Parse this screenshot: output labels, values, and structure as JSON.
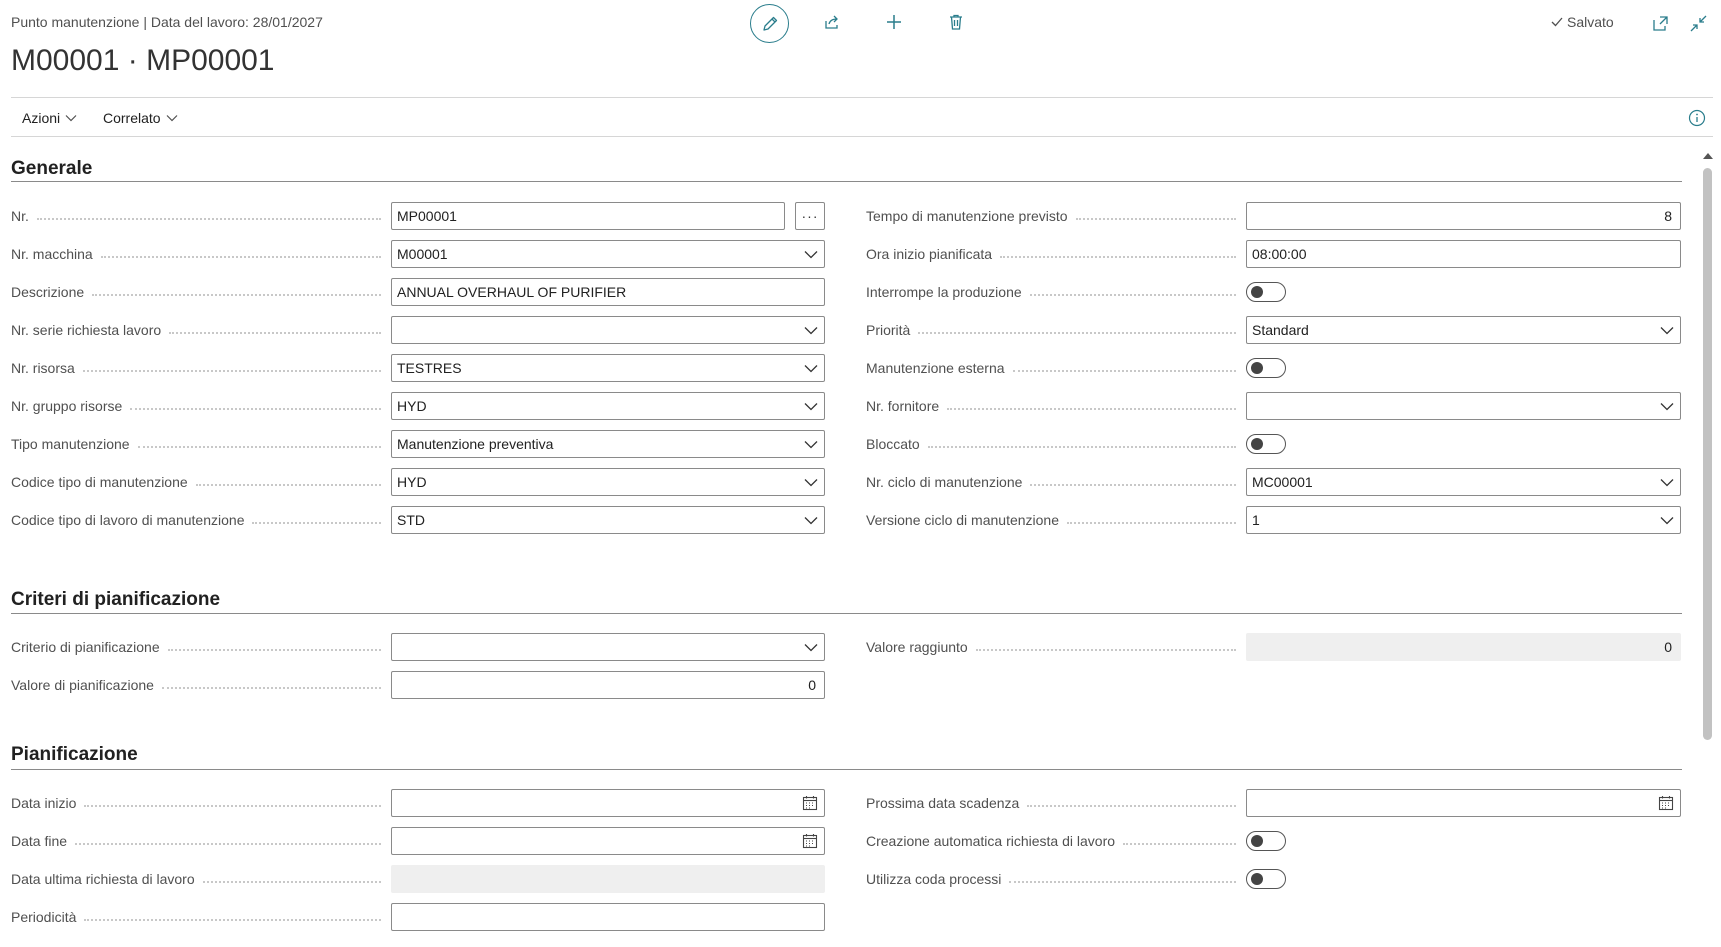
{
  "header": {
    "breadcrumb": "Punto manutenzione | Data del lavoro: 28/01/2027",
    "title": "M00001 · MP00001",
    "saved_label": "Salvato"
  },
  "actions": {
    "menu": [
      "Azioni",
      "Correlato"
    ]
  },
  "generale": {
    "title": "Generale",
    "left": [
      {
        "label": "Nr.",
        "value": "MP00001",
        "kind": "lookup"
      },
      {
        "label": "Nr. macchina",
        "value": "M00001",
        "kind": "dropdown"
      },
      {
        "label": "Descrizione",
        "value": "ANNUAL OVERHAUL OF PURIFIER",
        "kind": "text"
      },
      {
        "label": "Nr. serie richiesta lavoro",
        "value": "",
        "kind": "dropdown"
      },
      {
        "label": "Nr. risorsa",
        "value": "TESTRES",
        "kind": "dropdown"
      },
      {
        "label": "Nr. gruppo risorse",
        "value": "HYD",
        "kind": "dropdown"
      },
      {
        "label": "Tipo manutenzione",
        "value": "Manutenzione preventiva",
        "kind": "dropdown"
      },
      {
        "label": "Codice tipo di manutenzione",
        "value": "HYD",
        "kind": "dropdown"
      },
      {
        "label": "Codice tipo di lavoro di manutenzione",
        "value": "STD",
        "kind": "dropdown"
      }
    ],
    "right": [
      {
        "label": "Tempo di manutenzione previsto",
        "value": "8",
        "kind": "number"
      },
      {
        "label": "Ora inizio pianificata",
        "value": "08:00:00",
        "kind": "text"
      },
      {
        "label": "Interrompe la produzione",
        "value": "No",
        "kind": "toggle"
      },
      {
        "label": "Priorità",
        "value": "Standard",
        "kind": "dropdown"
      },
      {
        "label": "Manutenzione esterna",
        "value": "No",
        "kind": "toggle"
      },
      {
        "label": "Nr. fornitore",
        "value": "",
        "kind": "dropdown"
      },
      {
        "label": "Bloccato",
        "value": "No",
        "kind": "toggle"
      },
      {
        "label": "Nr. ciclo di manutenzione",
        "value": "MC00001",
        "kind": "dropdown"
      },
      {
        "label": "Versione ciclo di manutenzione",
        "value": "1",
        "kind": "dropdown"
      }
    ]
  },
  "criteri": {
    "title": "Criteri di pianificazione",
    "left": [
      {
        "label": "Criterio di pianificazione",
        "value": "",
        "kind": "dropdown"
      },
      {
        "label": "Valore di pianificazione",
        "value": "0",
        "kind": "number"
      }
    ],
    "right": [
      {
        "label": "Valore raggiunto",
        "value": "0",
        "kind": "readonly-number"
      }
    ]
  },
  "pianificazione": {
    "title": "Pianificazione",
    "left": [
      {
        "label": "Data inizio",
        "value": "",
        "kind": "date"
      },
      {
        "label": "Data fine",
        "value": "",
        "kind": "date"
      },
      {
        "label": "Data ultima richiesta di lavoro",
        "value": "",
        "kind": "readonly"
      },
      {
        "label": "Periodicità",
        "value": "",
        "kind": "text"
      }
    ],
    "right": [
      {
        "label": "Prossima data scadenza",
        "value": "",
        "kind": "date"
      },
      {
        "label": "Creazione automatica richiesta di lavoro",
        "value": "No",
        "kind": "toggle"
      },
      {
        "label": "Utilizza coda processi",
        "value": "No",
        "kind": "toggle"
      }
    ]
  }
}
